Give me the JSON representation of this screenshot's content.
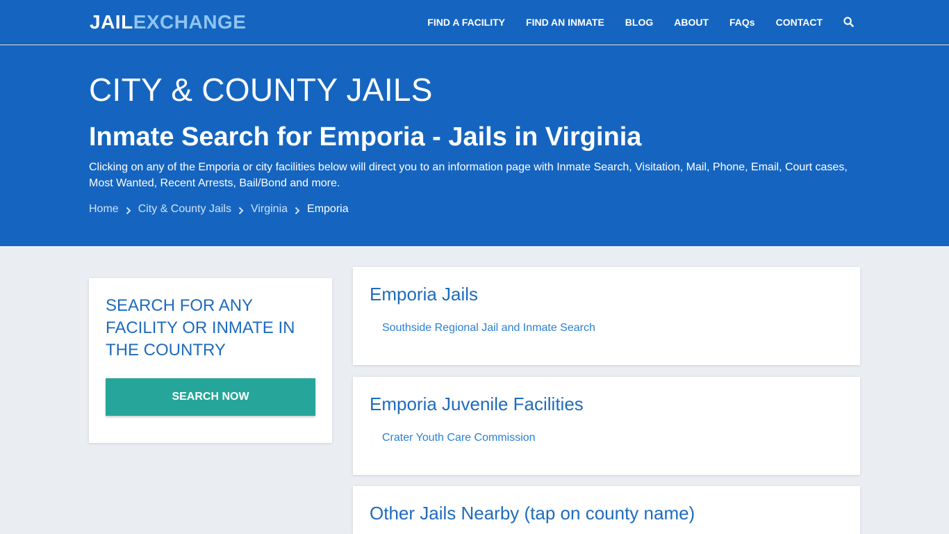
{
  "logo": {
    "part1": "JAIL",
    "part2": "EXCHANGE"
  },
  "nav": {
    "items": [
      "FIND A FACILITY",
      "FIND AN INMATE",
      "BLOG",
      "ABOUT",
      "FAQs",
      "CONTACT"
    ],
    "search_icon": "search-icon"
  },
  "hero": {
    "title": "CITY & COUNTY JAILS",
    "subtitle": "Inmate Search for Emporia - Jails in Virginia",
    "description": "Clicking on any of the Emporia or city facilities below will direct you to an information page with Inmate Search, Visitation, Mail, Phone, Email, Court cases, Most Wanted, Recent Arrests, Bail/Bond and more.",
    "breadcrumb": [
      "Home",
      "City & County Jails",
      "Virginia",
      "Emporia"
    ]
  },
  "sidebar": {
    "heading": "SEARCH FOR ANY FACILITY OR INMATE IN THE COUNTRY",
    "button_label": "SEARCH NOW"
  },
  "sections": [
    {
      "title": "Emporia Jails",
      "links": [
        "Southside Regional Jail and Inmate Search"
      ]
    },
    {
      "title": "Emporia Juvenile Facilities",
      "links": [
        "Crater Youth Care Commission"
      ]
    },
    {
      "title": "Other Jails Nearby (tap on county name)",
      "links": []
    }
  ],
  "colors": {
    "brand_blue": "#1565c0",
    "accent_teal": "#26a69a",
    "link_blue": "#2a7fd4"
  }
}
